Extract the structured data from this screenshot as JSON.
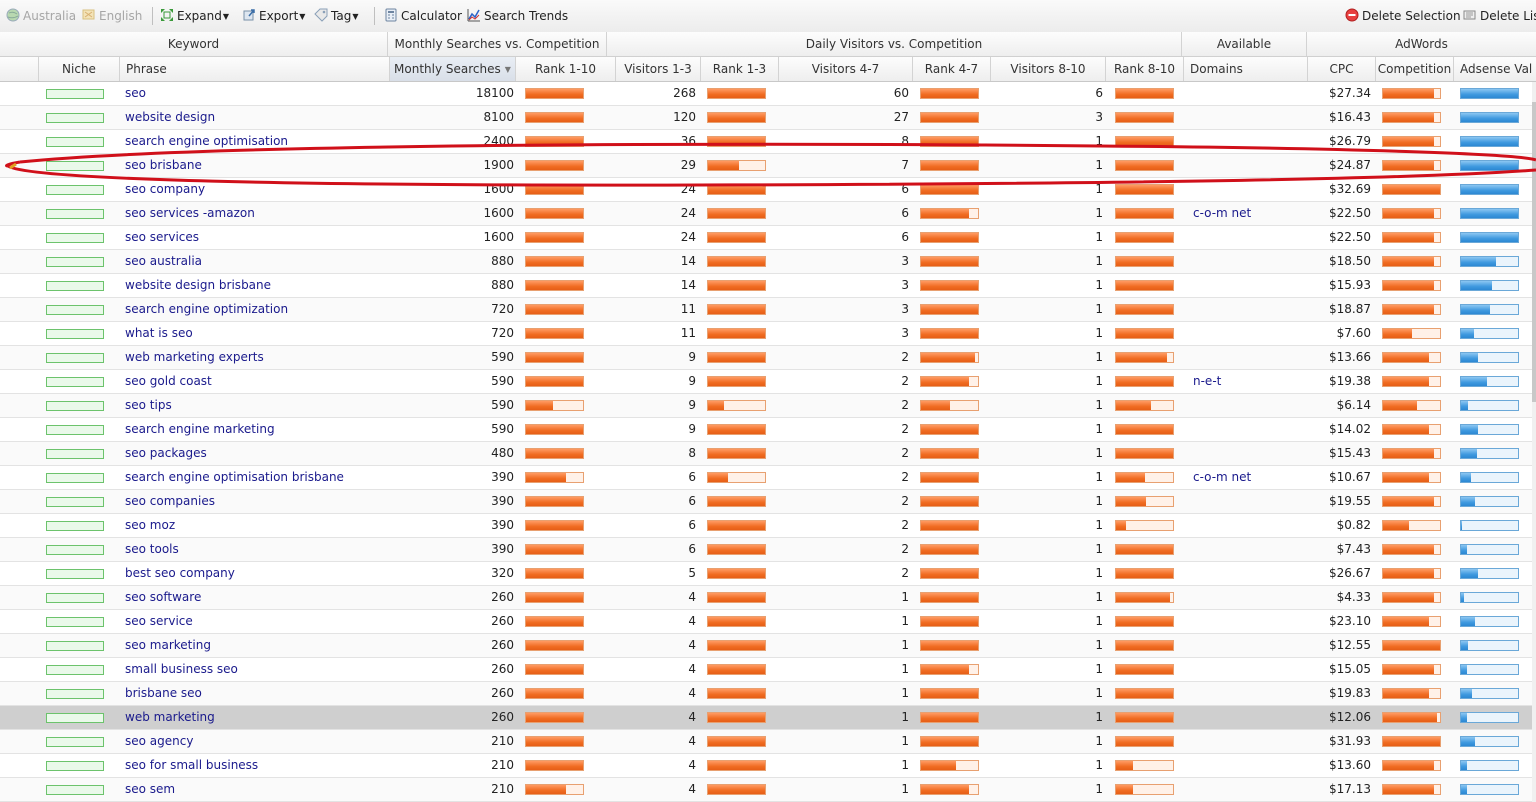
{
  "toolbar": {
    "country": "Australia",
    "language": "English",
    "expand": "Expand",
    "export": "Export",
    "tag": "Tag",
    "calculator": "Calculator",
    "search_trends": "Search Trends",
    "delete_selection": "Delete Selection",
    "delete_list": "Delete Lis"
  },
  "group_headers": {
    "keyword": "Keyword",
    "monthly_vs_competition": "Monthly Searches vs. Competition",
    "daily_vs_competition": "Daily Visitors vs. Competition",
    "available": "Available",
    "adwords": "AdWords"
  },
  "columns": {
    "niche": "Niche",
    "phrase": "Phrase",
    "monthly_searches": "Monthly Searches",
    "rank_1_10": "Rank 1-10",
    "visitors_1_3": "Visitors 1-3",
    "rank_1_3": "Rank 1-3",
    "visitors_4_7": "Visitors 4-7",
    "rank_4_7": "Rank 4-7",
    "visitors_8_10": "Visitors 8-10",
    "rank_8_10": "Rank 8-10",
    "domains": "Domains",
    "cpc": "CPC",
    "competition": "Competition",
    "adsense_val": "Adsense Val"
  },
  "colors": {
    "orange_bar": "#f06c22",
    "blue_bar": "#3f99df",
    "niche_green": "#6cc36c",
    "phrase_link": "#1a1a8c",
    "highlight_ellipse": "#d0101a",
    "selected_row": "#cfcfcf"
  },
  "rows": [
    {
      "phrase": "seo",
      "monthly": "18100",
      "r110": 1.0,
      "v13": "268",
      "r13": 1.0,
      "v47": "60",
      "r47": 1.0,
      "v810": "6",
      "r810": 1.0,
      "domains": "",
      "cpc": "$27.34",
      "comp": 0.9,
      "ads": 1.0
    },
    {
      "phrase": "website design",
      "monthly": "8100",
      "r110": 1.0,
      "v13": "120",
      "r13": 1.0,
      "v47": "27",
      "r47": 1.0,
      "v810": "3",
      "r810": 1.0,
      "domains": "",
      "cpc": "$16.43",
      "comp": 0.9,
      "ads": 1.0
    },
    {
      "phrase": "search engine optimisation",
      "monthly": "2400",
      "r110": 1.0,
      "v13": "36",
      "r13": 1.0,
      "v47": "8",
      "r47": 1.0,
      "v810": "1",
      "r810": 1.0,
      "domains": "",
      "cpc": "$26.79",
      "comp": 0.9,
      "ads": 1.0
    },
    {
      "phrase": "seo brisbane",
      "monthly": "1900",
      "r110": 1.0,
      "v13": "29",
      "r13": 0.55,
      "v47": "7",
      "r47": 1.0,
      "v810": "1",
      "r810": 1.0,
      "domains": "",
      "cpc": "$24.87",
      "comp": 0.9,
      "ads": 1.0
    },
    {
      "phrase": "seo company",
      "monthly": "1600",
      "r110": 1.0,
      "v13": "24",
      "r13": 1.0,
      "v47": "6",
      "r47": 1.0,
      "v810": "1",
      "r810": 1.0,
      "domains": "",
      "cpc": "$32.69",
      "comp": 1.0,
      "ads": 1.0
    },
    {
      "phrase": "seo services -amazon",
      "monthly": "1600",
      "r110": 1.0,
      "v13": "24",
      "r13": 1.0,
      "v47": "6",
      "r47": 0.85,
      "v810": "1",
      "r810": 1.0,
      "domains": "c-o-m net",
      "cpc": "$22.50",
      "comp": 0.9,
      "ads": 1.0
    },
    {
      "phrase": "seo services",
      "monthly": "1600",
      "r110": 1.0,
      "v13": "24",
      "r13": 1.0,
      "v47": "6",
      "r47": 1.0,
      "v810": "1",
      "r810": 1.0,
      "domains": "",
      "cpc": "$22.50",
      "comp": 0.9,
      "ads": 1.0
    },
    {
      "phrase": "seo australia",
      "monthly": "880",
      "r110": 1.0,
      "v13": "14",
      "r13": 1.0,
      "v47": "3",
      "r47": 1.0,
      "v810": "1",
      "r810": 1.0,
      "domains": "",
      "cpc": "$18.50",
      "comp": 0.9,
      "ads": 0.62
    },
    {
      "phrase": "website design brisbane",
      "monthly": "880",
      "r110": 1.0,
      "v13": "14",
      "r13": 1.0,
      "v47": "3",
      "r47": 1.0,
      "v810": "1",
      "r810": 1.0,
      "domains": "",
      "cpc": "$15.93",
      "comp": 0.9,
      "ads": 0.55
    },
    {
      "phrase": "search engine optimization",
      "monthly": "720",
      "r110": 1.0,
      "v13": "11",
      "r13": 1.0,
      "v47": "3",
      "r47": 1.0,
      "v810": "1",
      "r810": 1.0,
      "domains": "",
      "cpc": "$18.87",
      "comp": 0.9,
      "ads": 0.5
    },
    {
      "phrase": "what is seo",
      "monthly": "720",
      "r110": 1.0,
      "v13": "11",
      "r13": 1.0,
      "v47": "3",
      "r47": 1.0,
      "v810": "1",
      "r810": 1.0,
      "domains": "",
      "cpc": "$7.60",
      "comp": 0.5,
      "ads": 0.22
    },
    {
      "phrase": "web marketing experts",
      "monthly": "590",
      "r110": 1.0,
      "v13": "9",
      "r13": 1.0,
      "v47": "2",
      "r47": 0.95,
      "v810": "1",
      "r810": 0.9,
      "domains": "",
      "cpc": "$13.66",
      "comp": 0.8,
      "ads": 0.3
    },
    {
      "phrase": "seo gold coast",
      "monthly": "590",
      "r110": 1.0,
      "v13": "9",
      "r13": 1.0,
      "v47": "2",
      "r47": 0.85,
      "v810": "1",
      "r810": 1.0,
      "domains": "n-e-t",
      "cpc": "$19.38",
      "comp": 0.8,
      "ads": 0.45
    },
    {
      "phrase": "seo tips",
      "monthly": "590",
      "r110": 0.48,
      "v13": "9",
      "r13": 0.28,
      "v47": "2",
      "r47": 0.5,
      "v810": "1",
      "r810": 0.62,
      "domains": "",
      "cpc": "$6.14",
      "comp": 0.6,
      "ads": 0.12
    },
    {
      "phrase": "search engine marketing",
      "monthly": "590",
      "r110": 1.0,
      "v13": "9",
      "r13": 1.0,
      "v47": "2",
      "r47": 1.0,
      "v810": "1",
      "r810": 1.0,
      "domains": "",
      "cpc": "$14.02",
      "comp": 0.8,
      "ads": 0.3
    },
    {
      "phrase": "seo packages",
      "monthly": "480",
      "r110": 1.0,
      "v13": "8",
      "r13": 1.0,
      "v47": "2",
      "r47": 1.0,
      "v810": "1",
      "r810": 1.0,
      "domains": "",
      "cpc": "$15.43",
      "comp": 0.9,
      "ads": 0.28
    },
    {
      "phrase": "search engine optimisation brisbane",
      "monthly": "390",
      "r110": 0.7,
      "v13": "6",
      "r13": 0.35,
      "v47": "2",
      "r47": 1.0,
      "v810": "1",
      "r810": 0.5,
      "domains": "c-o-m net",
      "cpc": "$10.67",
      "comp": 0.8,
      "ads": 0.18
    },
    {
      "phrase": "seo companies",
      "monthly": "390",
      "r110": 1.0,
      "v13": "6",
      "r13": 1.0,
      "v47": "2",
      "r47": 1.0,
      "v810": "1",
      "r810": 0.52,
      "domains": "",
      "cpc": "$19.55",
      "comp": 0.9,
      "ads": 0.25
    },
    {
      "phrase": "seo moz",
      "monthly": "390",
      "r110": 1.0,
      "v13": "6",
      "r13": 1.0,
      "v47": "2",
      "r47": 1.0,
      "v810": "1",
      "r810": 0.18,
      "domains": "",
      "cpc": "$0.82",
      "comp": 0.45,
      "ads": 0.02
    },
    {
      "phrase": "seo tools",
      "monthly": "390",
      "r110": 1.0,
      "v13": "6",
      "r13": 1.0,
      "v47": "2",
      "r47": 1.0,
      "v810": "1",
      "r810": 1.0,
      "domains": "",
      "cpc": "$7.43",
      "comp": 0.9,
      "ads": 0.1
    },
    {
      "phrase": "best seo company",
      "monthly": "320",
      "r110": 1.0,
      "v13": "5",
      "r13": 1.0,
      "v47": "2",
      "r47": 1.0,
      "v810": "1",
      "r810": 1.0,
      "domains": "",
      "cpc": "$26.67",
      "comp": 0.9,
      "ads": 0.3
    },
    {
      "phrase": "seo software",
      "monthly": "260",
      "r110": 1.0,
      "v13": "4",
      "r13": 1.0,
      "v47": "1",
      "r47": 1.0,
      "v810": "1",
      "r810": 0.95,
      "domains": "",
      "cpc": "$4.33",
      "comp": 0.9,
      "ads": 0.05
    },
    {
      "phrase": "seo service",
      "monthly": "260",
      "r110": 1.0,
      "v13": "4",
      "r13": 1.0,
      "v47": "1",
      "r47": 1.0,
      "v810": "1",
      "r810": 1.0,
      "domains": "",
      "cpc": "$23.10",
      "comp": 0.8,
      "ads": 0.25
    },
    {
      "phrase": "seo marketing",
      "monthly": "260",
      "r110": 1.0,
      "v13": "4",
      "r13": 1.0,
      "v47": "1",
      "r47": 1.0,
      "v810": "1",
      "r810": 1.0,
      "domains": "",
      "cpc": "$12.55",
      "comp": 1.0,
      "ads": 0.12
    },
    {
      "phrase": "small business seo",
      "monthly": "260",
      "r110": 1.0,
      "v13": "4",
      "r13": 1.0,
      "v47": "1",
      "r47": 0.85,
      "v810": "1",
      "r810": 1.0,
      "domains": "",
      "cpc": "$15.05",
      "comp": 0.9,
      "ads": 0.1
    },
    {
      "phrase": "brisbane seo",
      "monthly": "260",
      "r110": 1.0,
      "v13": "4",
      "r13": 1.0,
      "v47": "1",
      "r47": 1.0,
      "v810": "1",
      "r810": 1.0,
      "domains": "",
      "cpc": "$19.83",
      "comp": 0.8,
      "ads": 0.2
    },
    {
      "phrase": "web marketing",
      "monthly": "260",
      "r110": 1.0,
      "v13": "4",
      "r13": 1.0,
      "v47": "1",
      "r47": 1.0,
      "v810": "1",
      "r810": 1.0,
      "domains": "",
      "cpc": "$12.06",
      "comp": 0.95,
      "ads": 0.1,
      "selected": true
    },
    {
      "phrase": "seo agency",
      "monthly": "210",
      "r110": 1.0,
      "v13": "4",
      "r13": 1.0,
      "v47": "1",
      "r47": 1.0,
      "v810": "1",
      "r810": 1.0,
      "domains": "",
      "cpc": "$31.93",
      "comp": 1.0,
      "ads": 0.25
    },
    {
      "phrase": "seo for small business",
      "monthly": "210",
      "r110": 1.0,
      "v13": "4",
      "r13": 1.0,
      "v47": "1",
      "r47": 0.62,
      "v810": "1",
      "r810": 0.3,
      "domains": "",
      "cpc": "$13.60",
      "comp": 0.9,
      "ads": 0.1
    },
    {
      "phrase": "seo sem",
      "monthly": "210",
      "r110": 0.7,
      "v13": "4",
      "r13": 1.0,
      "v47": "1",
      "r47": 0.85,
      "v810": "1",
      "r810": 0.3,
      "domains": "",
      "cpc": "$17.13",
      "comp": 0.9,
      "ads": 0.1
    }
  ]
}
